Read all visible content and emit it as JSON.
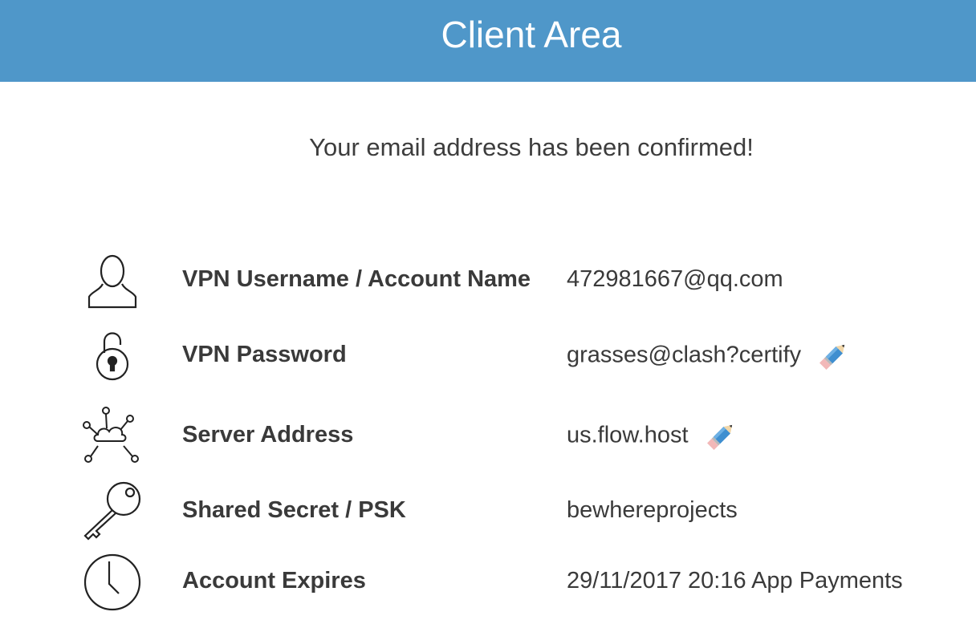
{
  "header": {
    "title": "Client Area"
  },
  "message": "Your email address has been confirmed!",
  "rows": [
    {
      "icon": "user-icon",
      "label": "VPN Username / Account Name",
      "value": "472981667@qq.com",
      "editable": false
    },
    {
      "icon": "padlock-open-icon",
      "label": "VPN Password",
      "value": "grasses@clash?certify",
      "editable": true
    },
    {
      "icon": "cloud-network-icon",
      "label": "Server Address",
      "value": "us.flow.host",
      "editable": true
    },
    {
      "icon": "key-icon",
      "label": "Shared Secret / PSK",
      "value": "bewhereprojects",
      "editable": false
    },
    {
      "icon": "clock-icon",
      "label": "Account Expires",
      "value": "29/11/2017 20:16 App Payments",
      "editable": false
    }
  ],
  "colors": {
    "header": "#4f97c9",
    "text": "#3a3a3a",
    "pencil": "#3f8fd0"
  }
}
